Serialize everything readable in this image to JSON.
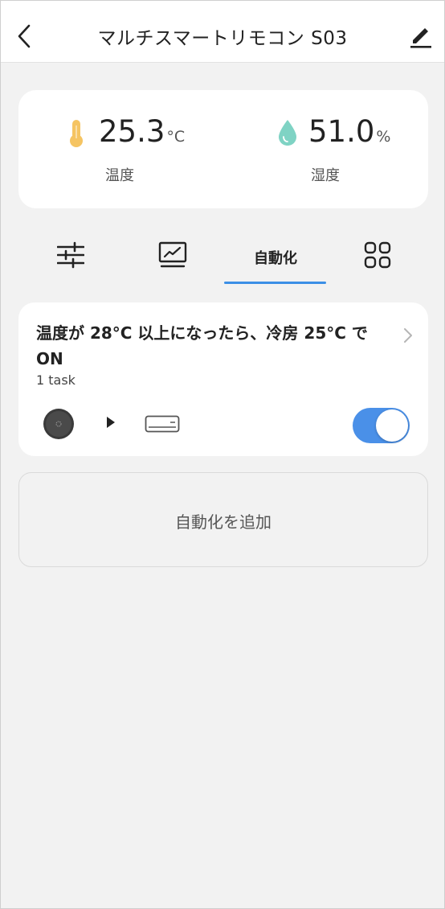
{
  "header": {
    "title": "マルチスマートリモコン S03",
    "back_icon": "chevron-left-icon",
    "edit_icon": "pencil-icon"
  },
  "sensors": {
    "temperature": {
      "value": "25.3",
      "unit": "°C",
      "label": "温度",
      "icon": "thermometer-icon",
      "color": "#f5c462"
    },
    "humidity": {
      "value": "51.0",
      "unit": "%",
      "label": "湿度",
      "icon": "water-drop-icon",
      "color": "#7fd3c4"
    }
  },
  "tabs": {
    "items": [
      {
        "icon": "sliders-icon"
      },
      {
        "icon": "chart-monitor-icon"
      },
      {
        "label": "自動化",
        "active": true
      },
      {
        "icon": "grid-icon"
      }
    ],
    "accent": "#3b8fe6"
  },
  "automation": {
    "title": "温度が 28°C 以上になったら、冷房 25°C でON",
    "subtitle": "1 task",
    "enabled": true,
    "toggle_color": "#4a90e8",
    "icons": [
      "hub-device-icon",
      "play-icon",
      "air-conditioner-icon"
    ]
  },
  "add_button": {
    "label": "自動化を追加"
  }
}
